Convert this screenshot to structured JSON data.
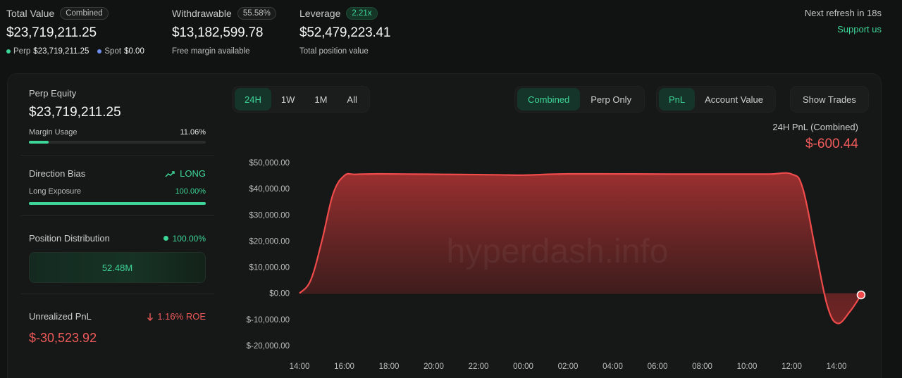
{
  "summary": {
    "total_value": {
      "title": "Total Value",
      "pill": "Combined",
      "value": "$23,719,211.25",
      "perp_label": "Perp",
      "perp_value": "$23,719,211.25",
      "spot_label": "Spot",
      "spot_value": "$0.00"
    },
    "withdrawable": {
      "title": "Withdrawable",
      "pill": "55.58%",
      "value": "$13,182,599.78",
      "sub": "Free margin available"
    },
    "leverage": {
      "title": "Leverage",
      "pill": "2.21x",
      "value": "$52,479,223.41",
      "sub": "Total position value"
    },
    "refresh": "Next refresh in 18s",
    "support": "Support us"
  },
  "left": {
    "equity": {
      "label": "Perp Equity",
      "value": "$23,719,211.25",
      "margin_label": "Margin Usage",
      "margin_value": "11.06%",
      "margin_fraction": 0.1106
    },
    "bias": {
      "label": "Direction Bias",
      "value": "LONG",
      "exposure_label": "Long Exposure",
      "exposure_value": "100.00%",
      "exposure_fraction": 1.0
    },
    "distribution": {
      "label": "Position Distribution",
      "value": "100.00%",
      "box": "52.48M"
    },
    "unrealized": {
      "label": "Unrealized PnL",
      "roe": "1.16% ROE",
      "value": "$-30,523.92"
    }
  },
  "controls": {
    "ranges": [
      "24H",
      "1W",
      "1M",
      "All"
    ],
    "modes": [
      "Combined",
      "Perp Only"
    ],
    "metrics": [
      "PnL",
      "Account Value"
    ],
    "trades": "Show Trades"
  },
  "colors": {
    "accent": "#3ed598",
    "negative": "#ef5a5a"
  },
  "chart_data": {
    "type": "area",
    "title": "24H PnL (Combined)",
    "current_value_label": "$-600.44",
    "y_ticks": [
      "$50,000.00",
      "$40,000.00",
      "$30,000.00",
      "$20,000.00",
      "$10,000.00",
      "$0.00",
      "$-10,000.00",
      "$-20,000.00"
    ],
    "x_ticks": [
      "14:00",
      "16:00",
      "18:00",
      "20:00",
      "22:00",
      "00:00",
      "02:00",
      "04:00",
      "06:00",
      "08:00",
      "10:00",
      "12:00",
      "14:00"
    ],
    "ylim": [
      -20000,
      50000
    ],
    "series": [
      {
        "values": [
          0,
          5000,
          20000,
          38000,
          45000,
          45500,
          45700,
          45600,
          45500,
          45400,
          45300,
          45200,
          45500,
          45700,
          45700,
          45650,
          45600,
          45600,
          45600,
          45600,
          45600,
          40000,
          15000,
          -5000,
          -11500,
          -7000,
          -600
        ]
      }
    ],
    "x_hours": [
      0,
      0.5,
      1.0,
      1.5,
      2.0,
      2.5,
      3.5,
      5,
      6.5,
      8,
      9,
      10,
      11,
      12,
      13.5,
      15,
      16.5,
      18,
      19.5,
      21,
      22,
      22.5,
      23.1,
      23.6,
      24.05,
      24.6,
      25.1
    ]
  }
}
